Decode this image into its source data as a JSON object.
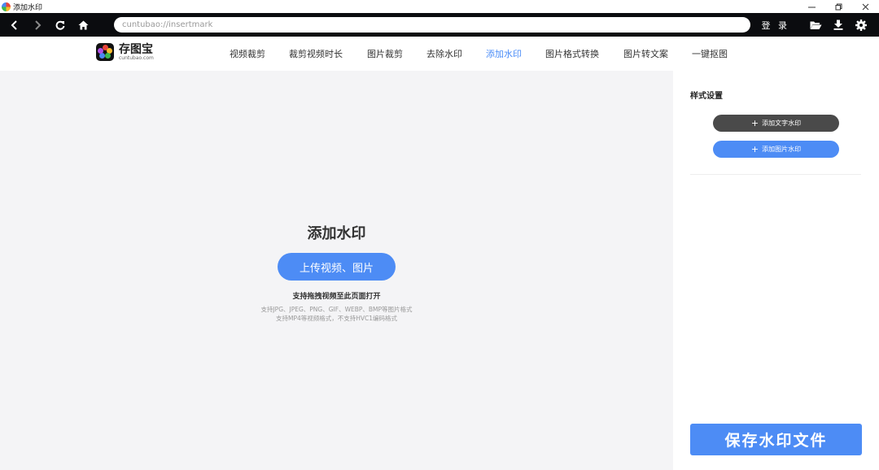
{
  "window": {
    "title": "添加水印",
    "controls": [
      "minimize-icon",
      "restore-icon",
      "close-icon"
    ]
  },
  "toolbar": {
    "address": "cuntubao://insertmark",
    "login_label": "登 录",
    "icons": [
      "back-icon",
      "forward-icon",
      "refresh-icon",
      "home-icon",
      "folder-icon",
      "download-icon",
      "settings-icon"
    ]
  },
  "site": {
    "logo_name": "存图宝",
    "logo_domain": "cuntubao.com",
    "nav": [
      {
        "label": "视频裁剪",
        "active": false
      },
      {
        "label": "裁剪视频时长",
        "active": false
      },
      {
        "label": "图片裁剪",
        "active": false
      },
      {
        "label": "去除水印",
        "active": false
      },
      {
        "label": "添加水印",
        "active": true
      },
      {
        "label": "图片格式转换",
        "active": false
      },
      {
        "label": "图片转文案",
        "active": false
      },
      {
        "label": "一键抠图",
        "active": false
      }
    ]
  },
  "main": {
    "title": "添加水印",
    "upload_label": "上传视频、图片",
    "drag_hint": "支持拖拽视频至此页面打开",
    "format_hints": [
      "支持JPG、JPEG、PNG、GIF、WEBP、BMP等图片格式",
      "支持MP4等视频格式，不支持HVC1编码格式"
    ]
  },
  "panel": {
    "title": "样式设置",
    "add_text_label": "添加文字水印",
    "add_image_label": "添加图片水印",
    "save_label": "保存水印文件"
  },
  "colors": {
    "accent": "#4d8cf5",
    "toolbar_bg": "#0b0c0f",
    "workspace_bg": "#f4f4f6",
    "dark_pill": "#4a4a4a"
  }
}
